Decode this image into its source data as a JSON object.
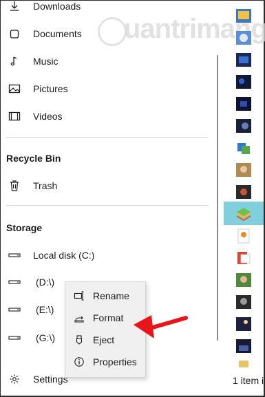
{
  "sidebar": {
    "items": [
      {
        "label": "Downloads",
        "icon": "download-icon"
      },
      {
        "label": "Documents",
        "icon": "document-icon"
      },
      {
        "label": "Music",
        "icon": "music-icon"
      },
      {
        "label": "Pictures",
        "icon": "pictures-icon"
      },
      {
        "label": "Videos",
        "icon": "videos-icon"
      }
    ],
    "recycle_title": "Recycle Bin",
    "trash_label": "Trash",
    "storage_title": "Storage",
    "drives": [
      {
        "label": "Local disk (C:)"
      },
      {
        "label": "(D:\\)"
      },
      {
        "label": "(E:\\)"
      },
      {
        "label": "(G:\\)"
      }
    ],
    "settings_label": "Settings"
  },
  "context_menu": {
    "items": [
      {
        "label": "Rename",
        "icon": "rename-icon"
      },
      {
        "label": "Format",
        "icon": "format-icon"
      },
      {
        "label": "Eject",
        "icon": "eject-icon"
      },
      {
        "label": "Properties",
        "icon": "info-icon"
      }
    ]
  },
  "status": {
    "text": "1 item i"
  },
  "watermark": {
    "text": "uantrimang"
  },
  "colors": {
    "selection": "#7fd0dc",
    "arrow": "#e8161b",
    "menu_bg": "#f0f0f0"
  }
}
